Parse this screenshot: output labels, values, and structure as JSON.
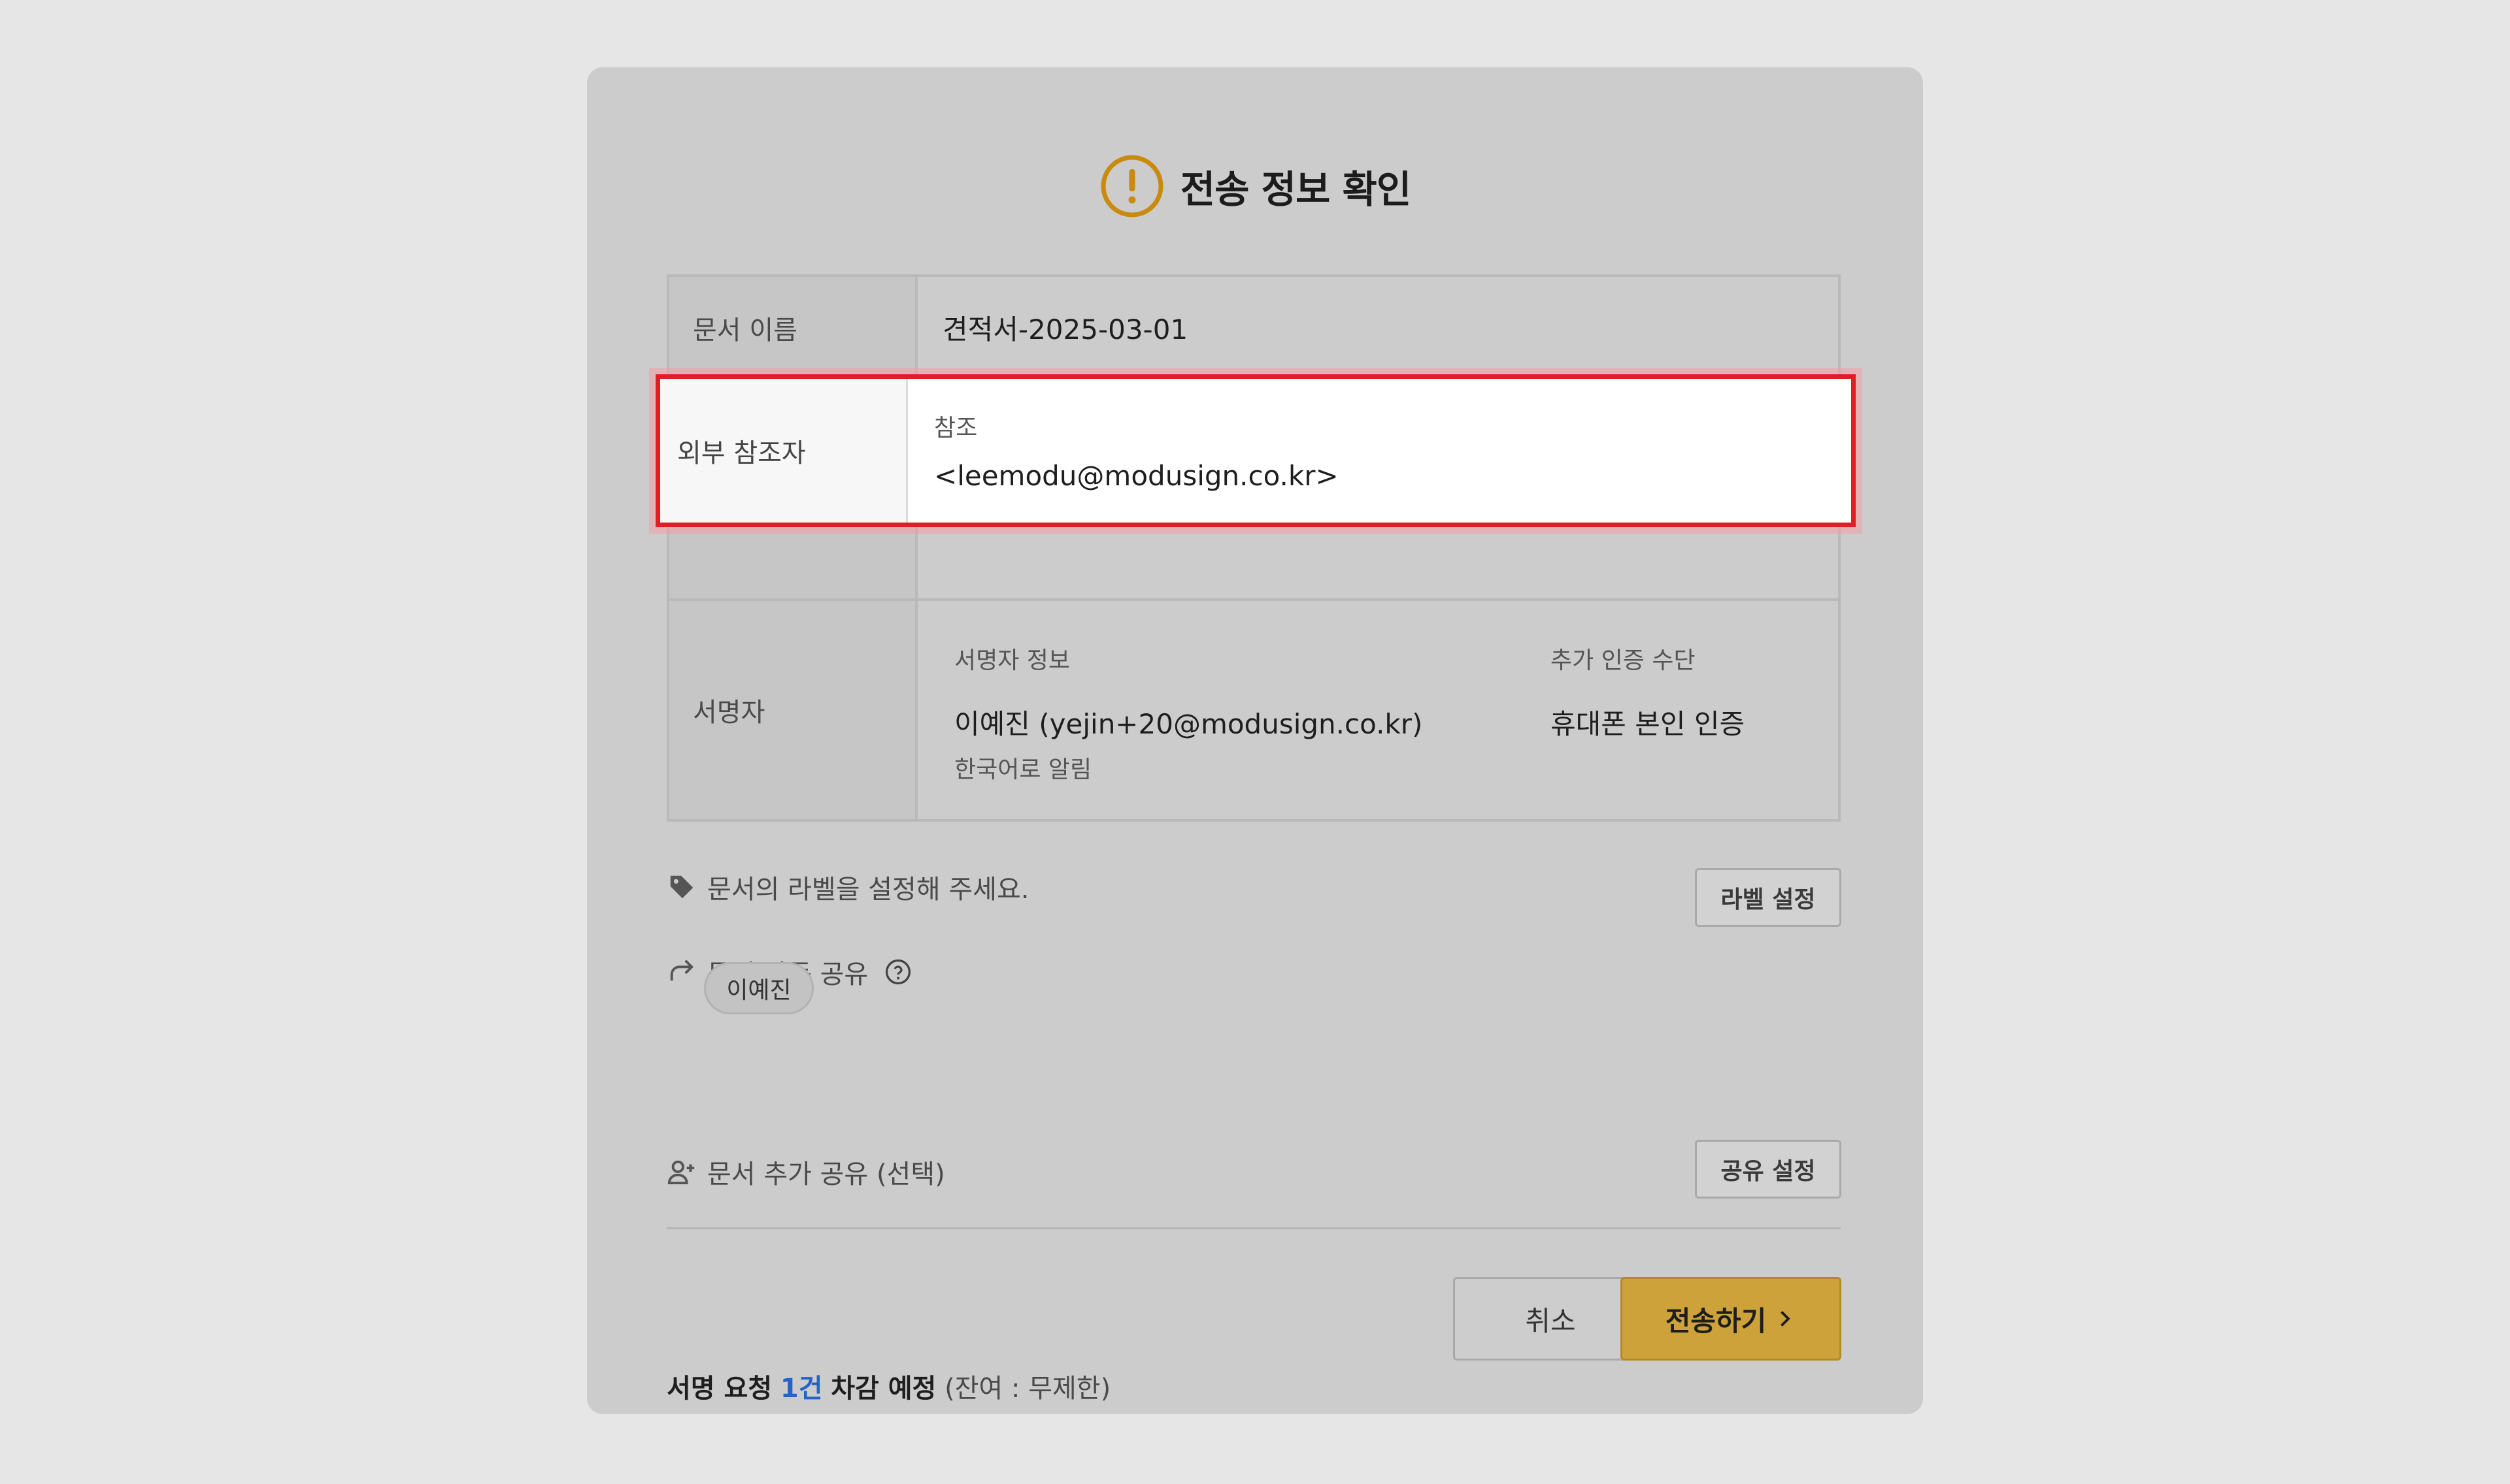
{
  "dialog": {
    "title": "전송 정보 확인",
    "icon": "warning-circle-icon",
    "accent_color": "#c98a0e"
  },
  "document": {
    "label": "문서 이름",
    "name": "견적서-2025-03-01"
  },
  "external_reference": {
    "label": "외부 참조자",
    "type": "참조",
    "email": "<leemodu@modusign.co.kr>",
    "highlight_color": "#e01e26"
  },
  "signer": {
    "label": "서명자",
    "info_header": "서명자 정보",
    "auth_header": "추가 인증 수단",
    "name_email": "이예진 (yejin+20@modusign.co.kr)",
    "auth_method": "휴대폰 본인 인증",
    "notification_language": "한국어로 알림"
  },
  "label_setting": {
    "text": "문서의 라벨을 설정해 주세요.",
    "button": "라벨 설정",
    "icon": "tag-icon"
  },
  "auto_share": {
    "text": "문서 자동 공유",
    "icon": "share-arrow-icon",
    "help_icon": "question-circle-icon",
    "recipients": [
      "이예진"
    ]
  },
  "additional_share": {
    "text": "문서 추가 공유 (선택)",
    "button": "공유 설정",
    "icon": "add-user-icon"
  },
  "footer": {
    "prefix": "서명 요청",
    "count": "1건",
    "suffix": "차감 예정",
    "note": "(잔여 : 무제한)",
    "count_color": "#2563c9"
  },
  "actions": {
    "cancel": "취소",
    "send": "전송하기",
    "send_color": "#cda23b"
  }
}
